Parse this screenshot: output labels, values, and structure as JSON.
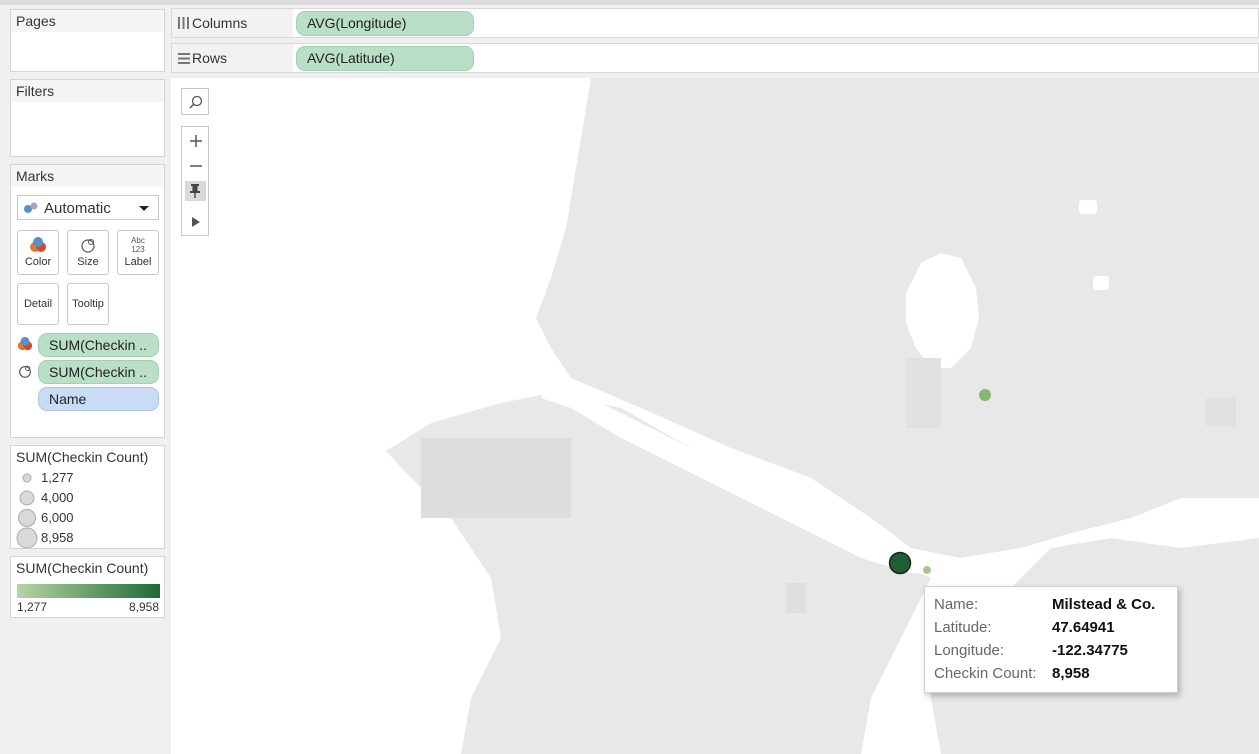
{
  "cards": {
    "pages": {
      "title": "Pages"
    },
    "filters": {
      "title": "Filters"
    },
    "marks": {
      "title": "Marks",
      "mark_type": "Automatic",
      "buttons": {
        "color": "Color",
        "size": "Size",
        "label": "Label",
        "detail": "Detail",
        "tooltip": "Tooltip"
      },
      "label_icon_text": "Abc\n123",
      "fields": [
        {
          "text": "SUM(Checkin ..",
          "icon": "color-icon"
        },
        {
          "text": "SUM(Checkin ..",
          "icon": "size-icon"
        },
        {
          "text": "Name",
          "icon": "detail"
        }
      ]
    }
  },
  "size_legend": {
    "title": "SUM(Checkin Count)",
    "items": [
      "1,277",
      "4,000",
      "6,000",
      "8,958"
    ]
  },
  "color_legend": {
    "title": "SUM(Checkin Count)",
    "min": "1,277",
    "max": "8,958",
    "colors": [
      "#b7d4a5",
      "#1e6b35"
    ]
  },
  "shelves": {
    "columns": {
      "label": "Columns",
      "pill": "AVG(Longitude)"
    },
    "rows": {
      "label": "Rows",
      "pill": "AVG(Latitude)"
    }
  },
  "map": {
    "land_color": "#e8e8e8",
    "water_color": "#ffffff",
    "marks": [
      {
        "name": "Milstead & Co.",
        "checkins": 8958,
        "color": "#1e5e32"
      },
      {
        "checkins": 1277,
        "color": "#a6c795"
      },
      {
        "checkins": 2900,
        "color": "#84b675"
      }
    ]
  },
  "tooltip": {
    "rows": [
      {
        "key": "Name:",
        "value": "Milstead & Co."
      },
      {
        "key": "Latitude:",
        "value": "47.64941"
      },
      {
        "key": "Longitude:",
        "value": "-122.34775"
      },
      {
        "key": "Checkin Count:",
        "value": "8,958"
      }
    ]
  }
}
